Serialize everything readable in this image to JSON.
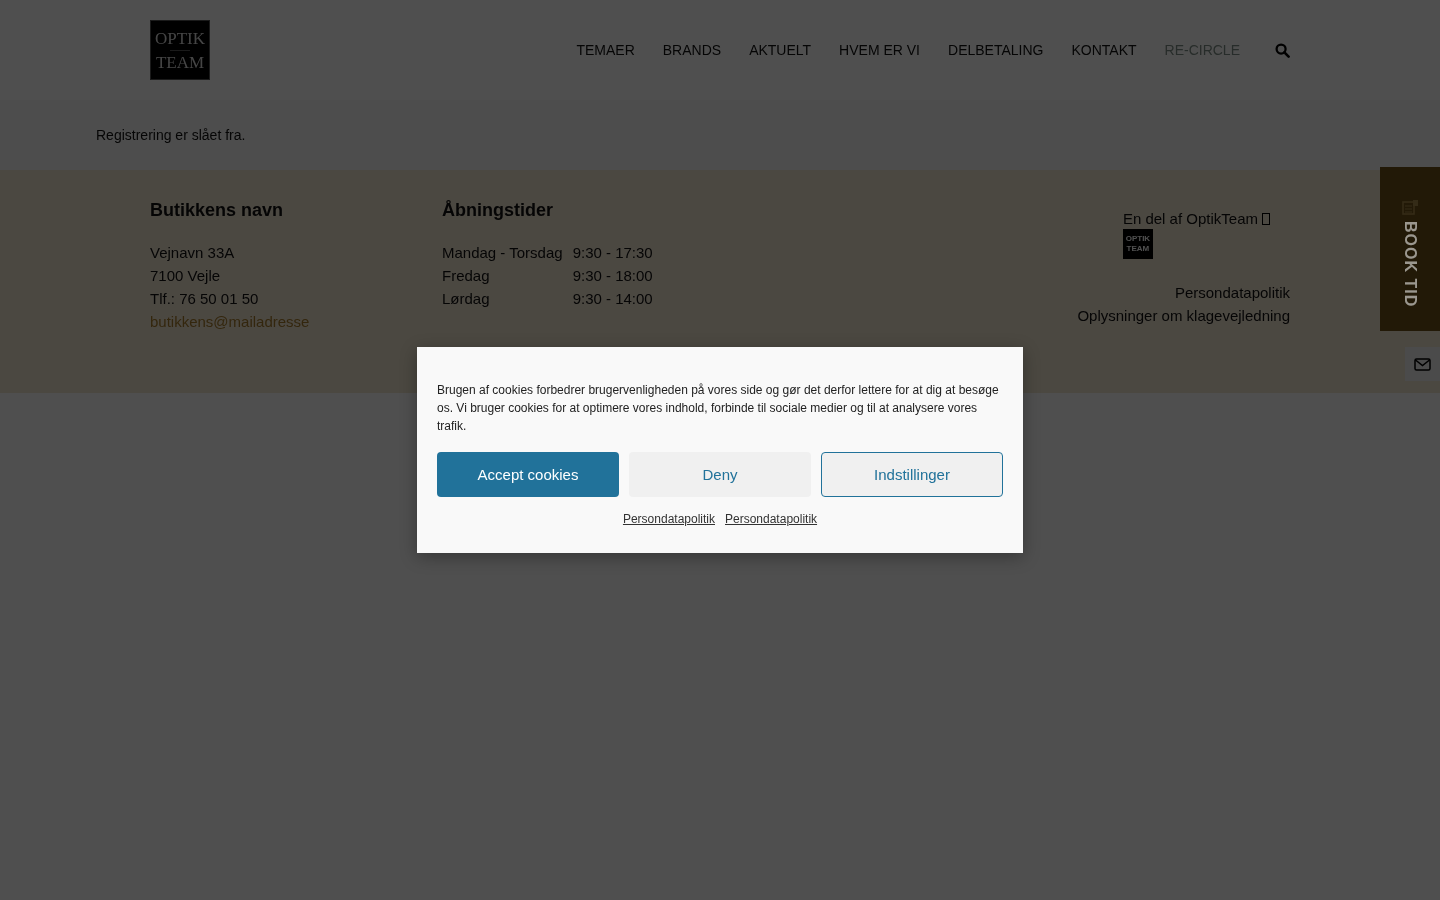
{
  "header": {
    "logo": {
      "top": "OPTIK",
      "bottom": "TEAM"
    },
    "nav": [
      {
        "label": "TEMAER",
        "selected": false
      },
      {
        "label": "BRANDS",
        "selected": false
      },
      {
        "label": "AKTUELT",
        "selected": false
      },
      {
        "label": "HVEM ER VI",
        "selected": false
      },
      {
        "label": "DELBETALING",
        "selected": false
      },
      {
        "label": "KONTAKT",
        "selected": false
      },
      {
        "label": "RE-CIRCLE",
        "selected": true
      }
    ]
  },
  "notice": "Registrering er slået fra.",
  "footer": {
    "store": {
      "title": "Butikkens navn",
      "lines": [
        "Vejnavn 33A",
        "7100 Vejle",
        "Tlf.: 76 50 01 50"
      ],
      "email": "butikkens@mailadresse"
    },
    "hours": {
      "title": "Åbningstider",
      "rows": [
        {
          "day": "Mandag - Torsdag",
          "time": "9:30 - 17:30"
        },
        {
          "day": "Fredag",
          "time": "9:30 - 18:00"
        },
        {
          "day": "Lørdag",
          "time": "9:30 - 14:00"
        }
      ]
    },
    "partner": {
      "text": "En del af OptikTeam",
      "logo": {
        "top": "OPTIK",
        "bottom": "TEAM"
      }
    },
    "links": [
      "Persondatapolitik",
      "Oplysninger om klagevejledning"
    ]
  },
  "side": {
    "book": "BOOK TID"
  },
  "cookie": {
    "text": "Brugen af cookies forbedrer brugervenligheden på vores side og gør det derfor lettere for at dig at besøge os. Vi bruger cookies for at optimere vores indhold, forbinde til sociale medier og til at analysere vores trafik.",
    "buttons": [
      {
        "label": "Accept cookies",
        "kind": "primary"
      },
      {
        "label": "Deny",
        "kind": "plain"
      },
      {
        "label": "Indstillinger",
        "kind": "outline"
      }
    ],
    "links": [
      "Persondatapolitik",
      "Persondatapolitik"
    ]
  }
}
